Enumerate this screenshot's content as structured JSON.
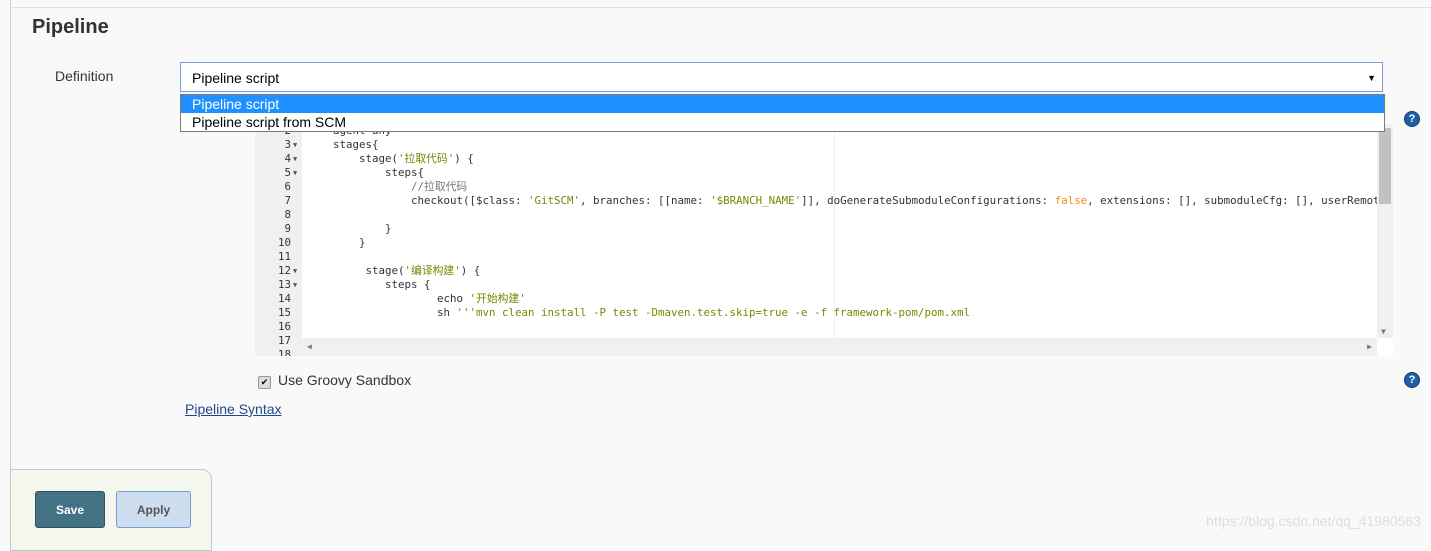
{
  "section_title": "Pipeline",
  "definition": {
    "label": "Definition",
    "selected": "Pipeline script",
    "options": [
      "Pipeline script",
      "Pipeline script from SCM"
    ]
  },
  "editor": {
    "lines": [
      {
        "n": "2",
        "fold": false,
        "indent": 4,
        "t": [
          [
            "",
            "agent any"
          ]
        ]
      },
      {
        "n": "3",
        "fold": true,
        "indent": 4,
        "t": [
          [
            "",
            "stages{"
          ]
        ]
      },
      {
        "n": "4",
        "fold": true,
        "indent": 8,
        "t": [
          [
            "",
            "stage("
          ],
          [
            "s",
            "'拉取代码'"
          ],
          [
            "",
            ") {"
          ]
        ]
      },
      {
        "n": "5",
        "fold": true,
        "indent": 12,
        "t": [
          [
            "",
            "steps{"
          ]
        ]
      },
      {
        "n": "6",
        "fold": false,
        "indent": 16,
        "t": [
          [
            "c",
            "//拉取代码"
          ]
        ]
      },
      {
        "n": "7",
        "fold": false,
        "indent": 16,
        "t": [
          [
            "",
            "checkout([$class: "
          ],
          [
            "s",
            "'GitSCM'"
          ],
          [
            "",
            ", branches: [[name: "
          ],
          [
            "s",
            "'$BRANCH_NAME'"
          ],
          [
            "",
            "]], doGenerateSubmoduleConfigurations: "
          ],
          [
            "k",
            "false"
          ],
          [
            "",
            ", extensions: [], submoduleCfg: [], userRemoteConfigs"
          ]
        ]
      },
      {
        "n": "8",
        "fold": false,
        "indent": 0,
        "t": []
      },
      {
        "n": "9",
        "fold": false,
        "indent": 12,
        "t": [
          [
            "",
            "}"
          ]
        ]
      },
      {
        "n": "10",
        "fold": false,
        "indent": 8,
        "t": [
          [
            "",
            "}"
          ]
        ]
      },
      {
        "n": "11",
        "fold": false,
        "indent": 0,
        "t": []
      },
      {
        "n": "12",
        "fold": true,
        "indent": 9,
        "t": [
          [
            "",
            "stage("
          ],
          [
            "s",
            "'编译构建'"
          ],
          [
            "",
            ") {"
          ]
        ]
      },
      {
        "n": "13",
        "fold": true,
        "indent": 12,
        "t": [
          [
            "",
            "steps {"
          ]
        ]
      },
      {
        "n": "14",
        "fold": false,
        "indent": 20,
        "t": [
          [
            "",
            "echo "
          ],
          [
            "s",
            "'开始构建'"
          ]
        ]
      },
      {
        "n": "15",
        "fold": false,
        "indent": 20,
        "t": [
          [
            "",
            "sh "
          ],
          [
            "s",
            "'''mvn clean install -P test -Dmaven.test.skip=true -e -f framework-pom/pom.xml"
          ]
        ]
      },
      {
        "n": "16",
        "fold": false,
        "indent": 0,
        "t": []
      },
      {
        "n": "17",
        "fold": false,
        "indent": 0,
        "t": []
      },
      {
        "n": "18",
        "fold": false,
        "indent": 0,
        "t": []
      }
    ]
  },
  "sandbox": {
    "label": "Use Groovy Sandbox",
    "checked": true
  },
  "syntax_link": "Pipeline Syntax",
  "buttons": {
    "save": "Save",
    "apply": "Apply"
  },
  "help_glyph": "?",
  "watermark": "https://blog.csdn.net/qq_41980563",
  "colors": {
    "save": "#437284",
    "apply": "#cfdeee",
    "selected_option": "#1e90ff",
    "string": "#6b8e00",
    "keyword": "#f28a1e"
  }
}
